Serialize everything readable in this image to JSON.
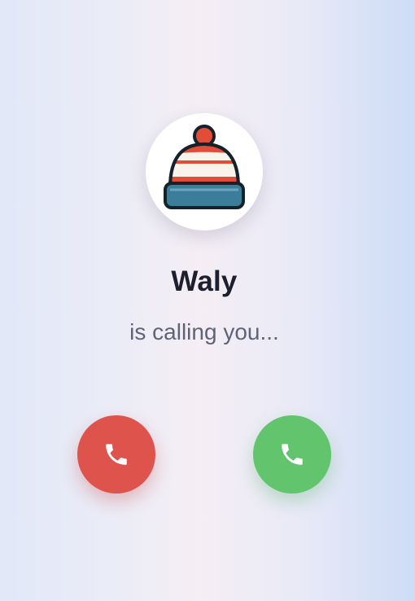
{
  "caller": {
    "name": "Waly",
    "status": "is calling you..."
  },
  "avatar": {
    "icon": "winter-hat-icon",
    "colors": {
      "stripe": "#e24d3a",
      "band": "#f8f4ea",
      "brim": "#3c7e99",
      "outline": "#15222a"
    }
  },
  "actions": {
    "decline": {
      "icon": "phone-icon",
      "color": "#df534d"
    },
    "accept": {
      "icon": "phone-icon",
      "color": "#62c46c"
    }
  }
}
